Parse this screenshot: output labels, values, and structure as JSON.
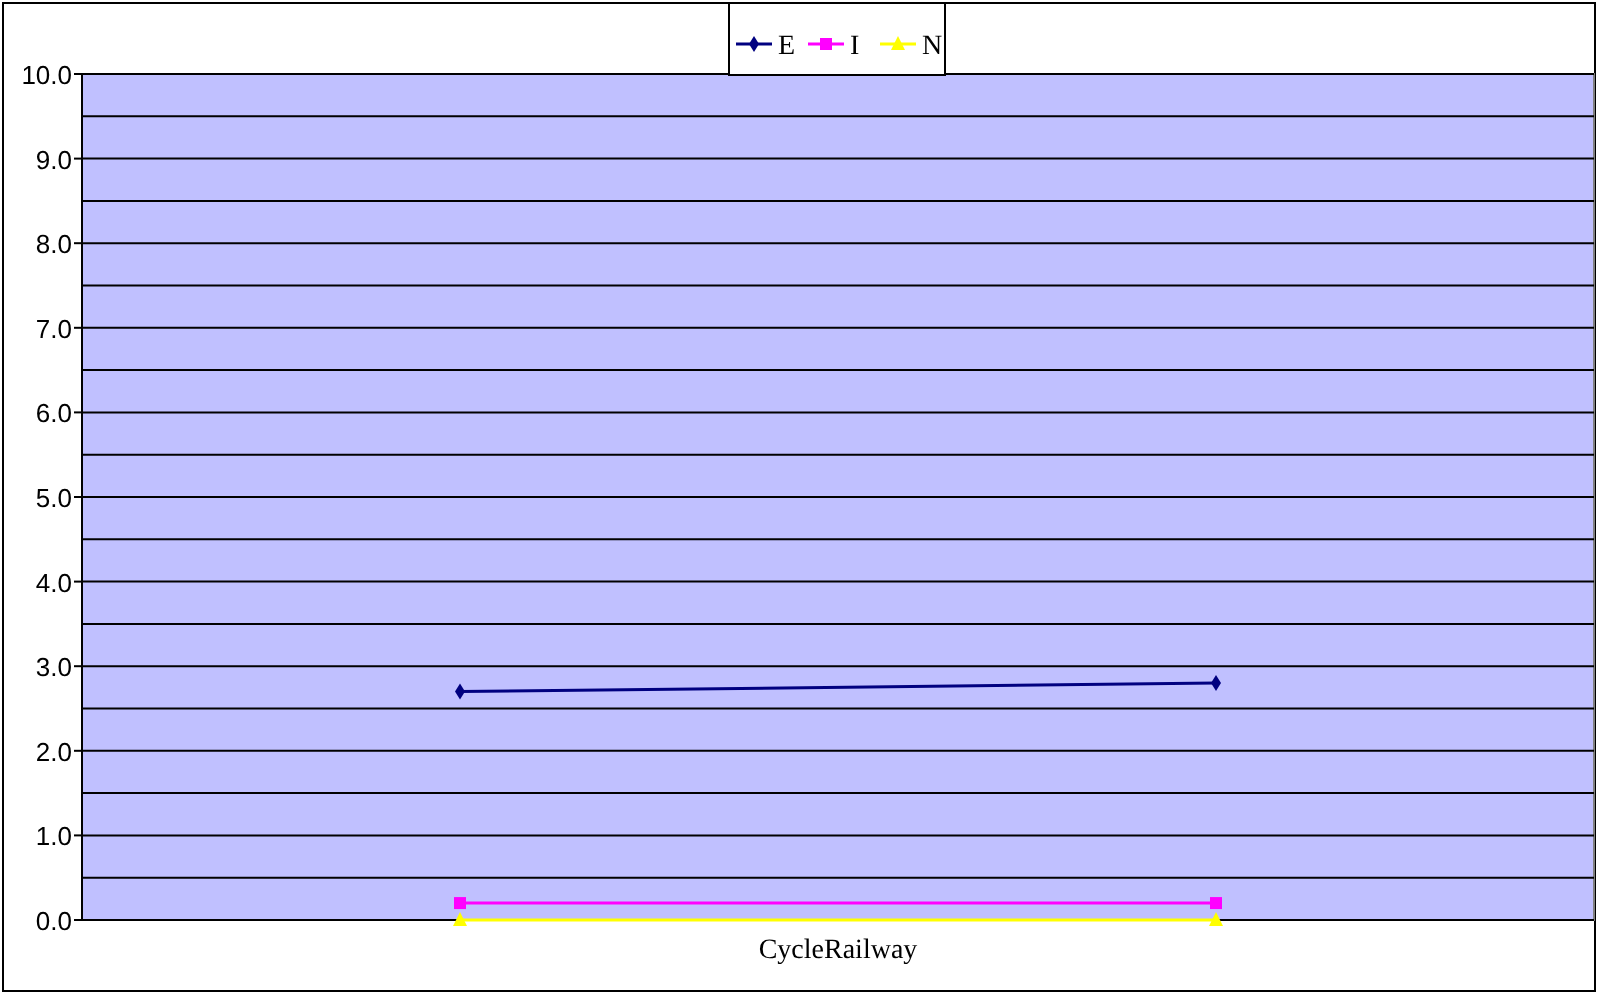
{
  "chart": {
    "chart_data": {
      "type": "line",
      "xlabel": "CycleRailway",
      "ylim": [
        0,
        10
      ],
      "grid": true,
      "legend": true,
      "yticks": [
        {
          "value": 0,
          "label": "0.0"
        },
        {
          "value": 1,
          "label": "1.0"
        },
        {
          "value": 2,
          "label": "2.0"
        },
        {
          "value": 3,
          "label": "3.0"
        },
        {
          "value": 4,
          "label": "4.0"
        },
        {
          "value": 5,
          "label": "5.0"
        },
        {
          "value": 6,
          "label": "6.0"
        },
        {
          "value": 7,
          "label": "7.0"
        },
        {
          "value": 8,
          "label": "8.0"
        },
        {
          "value": 9,
          "label": "9.0"
        },
        {
          "value": 10,
          "label": "10.0"
        }
      ],
      "series": [
        {
          "name": "E",
          "color": "#000080",
          "values": [
            2.7,
            2.8
          ],
          "marker": "diamond"
        },
        {
          "name": "I",
          "color": "#ff00ff",
          "values": [
            0.2,
            0.2
          ],
          "marker": "square"
        },
        {
          "name": "N",
          "color": "#ffff00",
          "values": [
            0,
            0
          ],
          "marker": "triangle"
        }
      ]
    }
  }
}
